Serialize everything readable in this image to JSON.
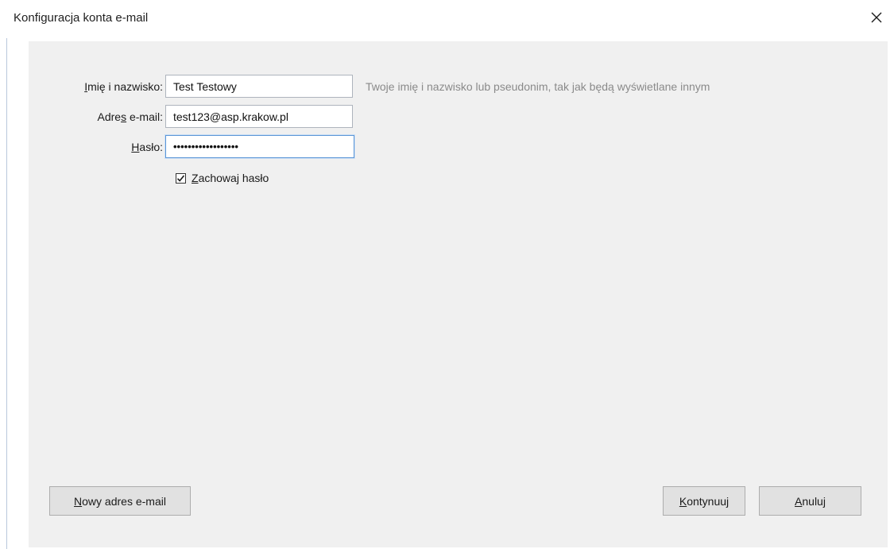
{
  "dialog": {
    "title": "Konfiguracja konta e-mail",
    "close_symbol": "close-icon"
  },
  "form": {
    "name": {
      "label_underlined": "I",
      "label_rest": "mię i nazwisko:",
      "value": "Test Testowy",
      "hint": "Twoje imię i nazwisko lub pseudonim, tak jak będą wyświetlane innym"
    },
    "email": {
      "label_pre": "Adre",
      "label_underlined": "s",
      "label_rest": " e-mail:",
      "value": "test123@asp.krakow.pl"
    },
    "password": {
      "label_underlined": "H",
      "label_rest": "asło:",
      "value": "••••••••••••••••••"
    },
    "remember_password": {
      "checked": true,
      "label_underlined": "Z",
      "label_rest": "achowaj hasło"
    }
  },
  "buttons": {
    "new_email": {
      "label_underlined": "N",
      "label_rest": "owy adres e-mail"
    },
    "continue": {
      "label_underlined": "K",
      "label_rest": "ontynuuj"
    },
    "cancel": {
      "label_underlined": "A",
      "label_rest": "nuluj"
    }
  },
  "colors": {
    "content_bg": "#f0f0f0",
    "focus_border": "#5a95d6",
    "hint_text": "#8a8a8a"
  }
}
